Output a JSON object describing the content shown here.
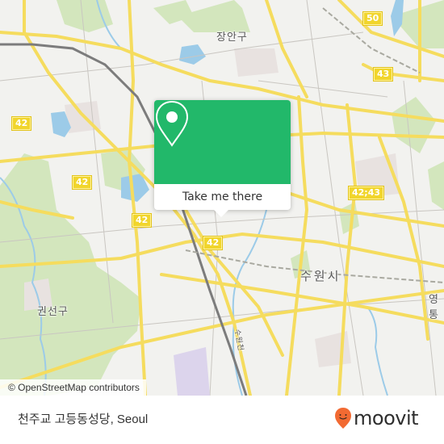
{
  "map": {
    "route_shields": [
      {
        "label": "50"
      },
      {
        "label": "43"
      },
      {
        "label": "42"
      },
      {
        "label": "42"
      },
      {
        "label": "42"
      },
      {
        "label": "42"
      },
      {
        "label": "42;43"
      }
    ],
    "place_labels": [
      {
        "label": "장안구"
      },
      {
        "label": "수원시"
      },
      {
        "label": "권선구"
      },
      {
        "label": "영통"
      },
      {
        "label": "수원천"
      }
    ],
    "colors": {
      "background": "#f2f2ef",
      "road": "#f5dc5e",
      "park": "#cfe5b4",
      "water": "#9ccbe8",
      "rail": "#777777"
    }
  },
  "popup": {
    "icon": "location-pin-icon",
    "button_label": "Take me there",
    "accent_color": "#22b86a"
  },
  "attribution": {
    "text": "© OpenStreetMap contributors"
  },
  "footer": {
    "title": "천주교 고등동성당, Seoul",
    "brand": "moovit",
    "brand_icon": "moovit-smiley-pin-icon",
    "brand_color": "#f26a32"
  }
}
